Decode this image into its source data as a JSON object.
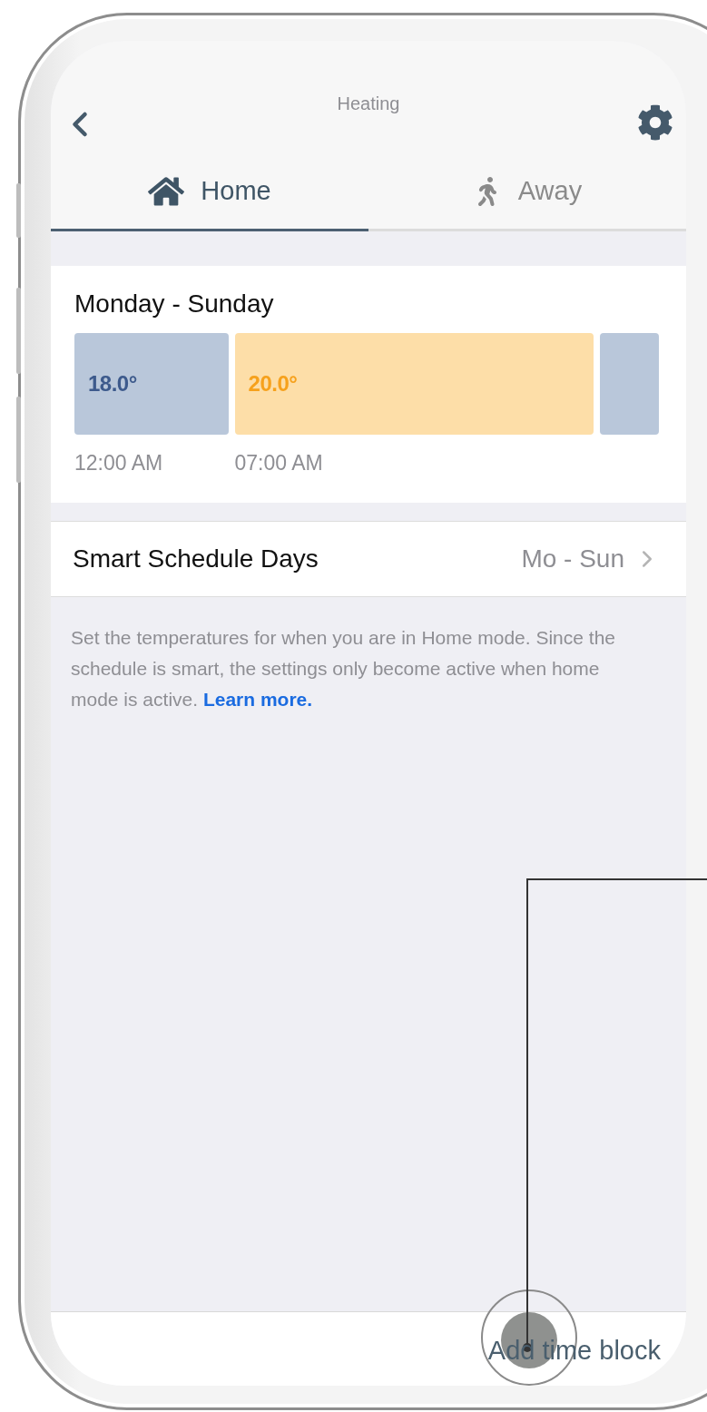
{
  "header": {
    "title": "Heating"
  },
  "tabs": [
    {
      "label": "Home",
      "selected": true
    },
    {
      "label": "Away",
      "selected": false
    }
  ],
  "schedule": {
    "title": "Monday - Sunday",
    "blocks": [
      {
        "kind": "cold",
        "temp": "18.0°",
        "time": "12:00 AM"
      },
      {
        "kind": "warm",
        "temp": "20.0°",
        "time": "07:00 AM"
      },
      {
        "kind": "cold"
      }
    ]
  },
  "days_row": {
    "label": "Smart Schedule Days",
    "value": "Mo - Sun"
  },
  "description": {
    "text": "Set the temperatures for when you are in Home mode. Since the schedule is smart, the settings only become active when home mode is active.",
    "link": "Learn more."
  },
  "footer": {
    "action": "Add time block"
  },
  "touch_hint": {
    "shown": true
  }
}
